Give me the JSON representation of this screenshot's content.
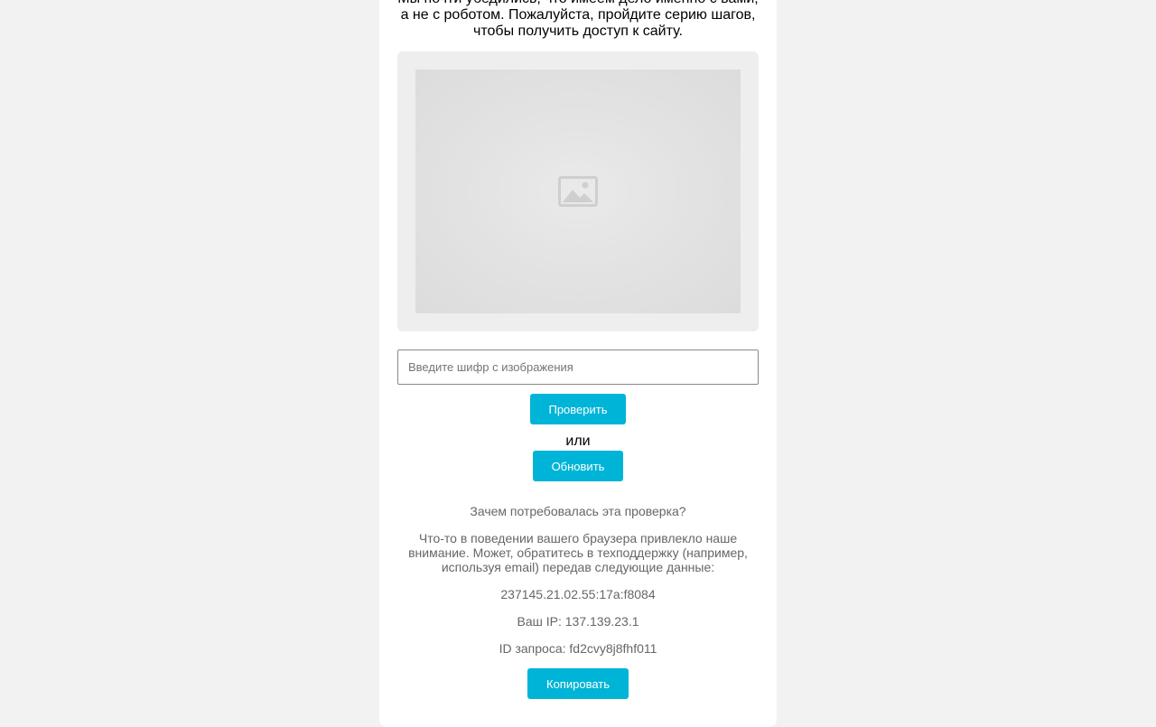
{
  "intro_text": "Мы почти убедились, что имеем дело именно с вами, а не с роботом. Пожалуйста, пройдите серию шагов, чтобы получить доступ к сайту.",
  "captcha": {
    "image_icon": "image-placeholder-icon",
    "input_placeholder": "Введите шифр с изображения",
    "input_value": ""
  },
  "buttons": {
    "check_label": "Проверить",
    "or_label": "или",
    "refresh_label": "Обновить",
    "copy_label": "Копировать"
  },
  "info": {
    "title": "Зачем потребовалась эта проверка?",
    "text": "Что-то в поведении вашего браузера привлекло наше внимание. Может, обратитесь в техподдержку (например, используя email) передав следующие данные:",
    "code": "237145.21.02.55:17a:f8084",
    "ip": "Ваш IP: 137.139.23.1",
    "request_id": "ID запроса: fd2cvy8j8fhf011"
  },
  "colors": {
    "background": "#f2f2f2",
    "accent": "#00b4d8",
    "muted_text": "#666666"
  }
}
